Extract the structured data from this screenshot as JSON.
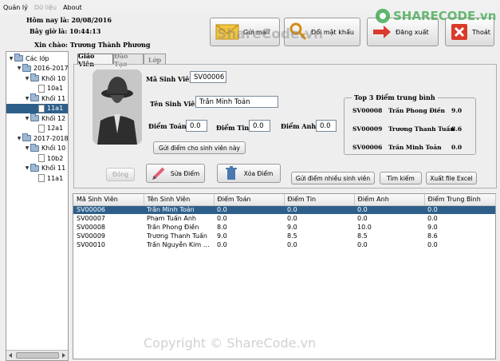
{
  "menu": [
    {
      "label": "Quản lý",
      "enabled": true
    },
    {
      "label": "Dữ liệu",
      "enabled": false
    },
    {
      "label": "About",
      "enabled": true
    }
  ],
  "header": {
    "date_text": "Hôm nay là: 20/08/2016",
    "time_text": "Bây giờ là: 10:44:13",
    "greeting": "Xin chào: Trương Thành Phương"
  },
  "toolbar": {
    "send_label": "Gửi mail",
    "change_password_label": "Đổi mật khẩu",
    "logout_label": "Đăng xuất",
    "exit_label": "Thoát"
  },
  "tree": [
    {
      "label": "Các lớp",
      "type": "folder",
      "level": 0,
      "expanded": true
    },
    {
      "label": "2016-2017",
      "type": "folder",
      "level": 1,
      "expanded": true
    },
    {
      "label": "Khối 10",
      "type": "folder",
      "level": 2,
      "expanded": true
    },
    {
      "label": "10a1",
      "type": "file",
      "level": 3
    },
    {
      "label": "Khối 11",
      "type": "folder",
      "level": 2,
      "expanded": true
    },
    {
      "label": "11a1",
      "type": "file",
      "level": 3,
      "selected": true
    },
    {
      "label": "Khối 12",
      "type": "folder",
      "level": 2,
      "expanded": true
    },
    {
      "label": "12a1",
      "type": "file",
      "level": 3
    },
    {
      "label": "2017-2018",
      "type": "folder",
      "level": 1,
      "expanded": true
    },
    {
      "label": "Khối 10",
      "type": "folder",
      "level": 2,
      "expanded": true
    },
    {
      "label": "10b2",
      "type": "file",
      "level": 3
    },
    {
      "label": "Khối 11",
      "type": "folder",
      "level": 2,
      "expanded": true
    },
    {
      "label": "11a1",
      "type": "file",
      "level": 3
    }
  ],
  "tabs": [
    {
      "label": "Giáo Viên",
      "active": true
    },
    {
      "label": "Đào Tạo",
      "active": false
    },
    {
      "label": "Lớp",
      "active": false
    }
  ],
  "form": {
    "student_id_label": "Mã Sinh Viên:",
    "student_id_value": "SV00006",
    "student_name_label": "Tên Sinh Viên:",
    "student_name_value": "Trần Minh Toản",
    "math_label": "Điểm Toán:",
    "math_value": "0.0",
    "it_label": "Điểm Tin:",
    "it_value": "0.0",
    "english_label": "Điểm Anh:",
    "english_value": "0.0",
    "send_score_label": "Gửi điểm cho sinh viên này"
  },
  "top3": {
    "title": "Top 3 Điểm trung bình",
    "rows": [
      {
        "id": "SV00008",
        "name": "Trần Phong Điền",
        "score": "9.0"
      },
      {
        "id": "SV00009",
        "name": "Trương Thanh Tuấn",
        "score": "8.6"
      },
      {
        "id": "SV00006",
        "name": "Trần Minh Toản",
        "score": "0.0"
      }
    ]
  },
  "actions": {
    "close_label": "Đóng",
    "edit_label": "Sửa Điểm",
    "delete_label": "Xóa Điểm",
    "send_many_label": "Gửi điểm nhiều sinh viên",
    "search_label": "Tìm kiếm",
    "export_label": "Xuất file Excel"
  },
  "table": {
    "headers": [
      "Mã Sinh Viên",
      "Tên Sinh Viên",
      "Điểm Toán",
      "Điểm Tin",
      "Điểm Anh",
      "Điểm Trung Bình"
    ],
    "rows": [
      [
        "SV00006",
        "Trần Minh Toản",
        "0.0",
        "0.0",
        "0.0",
        "0.0"
      ],
      [
        "SV00007",
        "Phạm Tuấn Anh",
        "0.0",
        "0.0",
        "0.0",
        "0.0"
      ],
      [
        "SV00008",
        "Trần Phong Điền",
        "8.0",
        "9.0",
        "10.0",
        "9.0"
      ],
      [
        "SV00009",
        "Trương Thanh Tuấn",
        "9.0",
        "8.5",
        "8.5",
        "8.6"
      ],
      [
        "SV00010",
        "Trần Nguyễn Kim Qu...",
        "0.0",
        "0.0",
        "0.0",
        "0.0"
      ]
    ],
    "selected_row": 0
  },
  "watermark": {
    "logo_text": "SHARECODE.vn",
    "overlay_text": "ShareCode.vn",
    "copyright_text": "Copyright © ShareCode.vn"
  },
  "colors": {
    "selection": "#2e5f8a",
    "exit_icon_red": "#d93a2b",
    "mail_yellow": "#f3c640",
    "logo_green": "#3aa64a"
  }
}
